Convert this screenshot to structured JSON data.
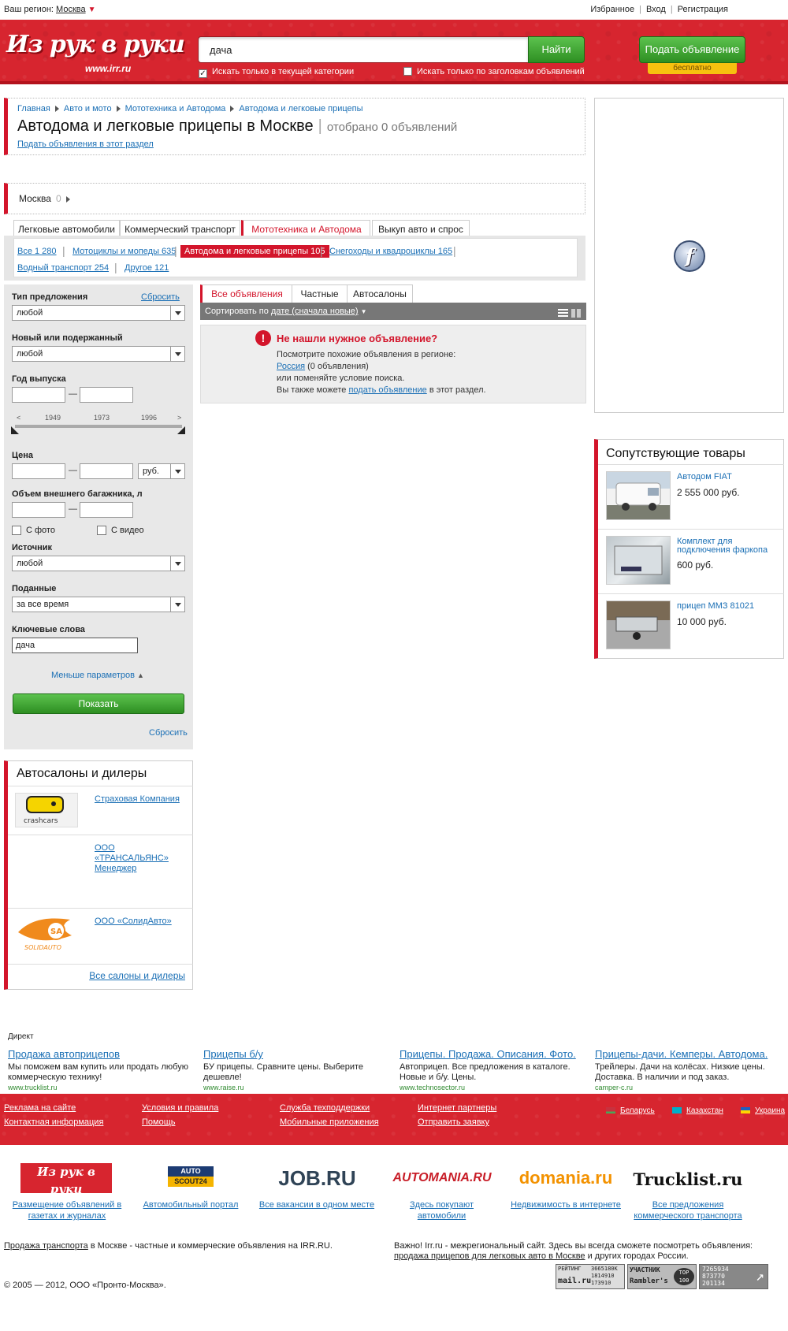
{
  "topbar": {
    "region_label": "Ваш регион:",
    "region_value": "Москва",
    "favorites": "Избранное",
    "login": "Вход",
    "register": "Регистрация"
  },
  "header": {
    "logo": "Из рук в руки",
    "logo_url": "www.irr.ru",
    "search_value": "дача",
    "find_button": "Найти",
    "chk_current_category": "Искать только в текущей категории",
    "chk_titles_only": "Искать только по заголовкам объявлений",
    "post_button": "Подать объявление",
    "post_free": "бесплатно"
  },
  "breadcrumb": [
    "Главная",
    "Авто и мото",
    "Мототехника и Автодома",
    "Автодома и легковые прицепы"
  ],
  "page": {
    "title": "Автодома и легковые прицепы в Москве",
    "count_text": "отобрано 0 объявлений",
    "post_link": "Подать объявления в этот раздел"
  },
  "city": {
    "name": "Москва",
    "count": "0"
  },
  "tabs": [
    "Легковые автомобили",
    "Коммерческий транспорт",
    "Мототехника и Автодома",
    "Выкуп авто и спрос"
  ],
  "subcats": [
    "Все 1 280",
    "Мотоциклы и мопеды 635",
    "Автодома и легковые прицепы 105",
    "Снегоходы и квадроциклы 165",
    "Водный транспорт 254",
    "Другое 121"
  ],
  "filter": {
    "offer_type_label": "Тип предложения",
    "reset_top": "Сбросить",
    "offer_type_value": "любой",
    "new_used_label": "Новый или подержанный",
    "new_used_value": "любой",
    "year_label": "Год выпуска",
    "slider_ticks": [
      "<",
      "1949",
      "1973",
      "1996",
      ">"
    ],
    "price_label": "Цена",
    "currency": "руб.",
    "trunk_label": "Объем внешнего багажника, л",
    "with_photo": "С фото",
    "with_video": "С видео",
    "source_label": "Источник",
    "source_value": "любой",
    "submitted_label": "Поданные",
    "submitted_value": "за все время",
    "keywords_label": "Ключевые слова",
    "keywords_value": "дача",
    "fewer_params": "Меньше параметров",
    "show_button": "Показать",
    "reset_bottom": "Сбросить"
  },
  "results": {
    "tabs": [
      "Все объявления",
      "Частные",
      "Автосалоны"
    ],
    "sort_prefix": "Сортировать по",
    "sort_value": "дате (сначала новые)",
    "notfound_title": "Не нашли нужное объявление?",
    "notfound_line1": "Посмотрите похожие объявления в регионе:",
    "notfound_region": "Россия",
    "notfound_region_count": "(0 объявления)",
    "notfound_line3": "или поменяйте условие поиска.",
    "notfound_line4_pre": "Вы также можете",
    "notfound_line4_link": "подать объявление",
    "notfound_line4_post": "в этот раздел."
  },
  "related": {
    "title": "Сопутствующие товары",
    "items": [
      {
        "title": "Автодом FIAT",
        "price": "2 555 000 руб."
      },
      {
        "title": "Комплект для подключения фаркопа",
        "price": "600 руб."
      },
      {
        "title": "прицеп ММЗ 81021",
        "price": "10 000 руб."
      }
    ]
  },
  "dealers": {
    "title": "Автосалоны и дилеры",
    "items": [
      "Страховая Компания",
      "ООО «ТРАНСАЛЬЯНС» Менеджер",
      "ООО «СолидАвто»"
    ],
    "logo_texts": [
      "crashcars",
      "SOLIDAUTO"
    ],
    "all_link": "Все салоны и дилеры"
  },
  "direct": {
    "label": "Директ",
    "ads": [
      {
        "title": "Продажа автоприцепов",
        "desc": "Мы поможем вам купить или продать любую коммерческую технику!",
        "url": "www.trucklist.ru"
      },
      {
        "title": "Прицепы б/у",
        "desc": "БУ прицепы. Сравните цены. Выберите дешевле!",
        "url": "www.raise.ru"
      },
      {
        "title": "Прицепы. Продажа. Описания. Фото.",
        "desc": "Автоприцеп. Все предложения в каталоге. Новые и б/у. Цены.",
        "url": "www.technosector.ru"
      },
      {
        "title": "Прицепы-дачи. Кемперы. Автодома.",
        "desc": "Трейлеры. Дачи на колёсах. Низкие цены. Доставка. В наличии и под заказ.",
        "url": "camper-c.ru"
      }
    ]
  },
  "footer": {
    "links_col1": [
      "Реклама на сайте",
      "Контактная информация"
    ],
    "links_col2": [
      "Условия и правила",
      "Помощь"
    ],
    "links_col3": [
      "Служба техподдержки",
      "Мобильные приложения"
    ],
    "links_col4": [
      "Интернет партнеры",
      "Отправить заявку"
    ],
    "countries": [
      "Беларусь",
      "Казахстан",
      "Украина"
    ]
  },
  "partners": [
    {
      "logo": "Из рук в руки",
      "logo_sub": "ИНТЕРНЕТ - ОФИС",
      "caption": "Размещение объявлений в газетах и журналах"
    },
    {
      "logo": "AUTO",
      "logo_sub": "SCOUT24",
      "caption": "Автомобильный портал"
    },
    {
      "logo": "JOB.RU",
      "caption": "Все вакансии в одном месте"
    },
    {
      "logo": "AUTOMANIA.RU",
      "caption": "Здесь покупают автомобили"
    },
    {
      "logo": "domania.ru",
      "caption": "Недвижимость в интернете"
    },
    {
      "logo": "Trucklist.ru",
      "caption": "Все предложения коммерческого транспорта"
    }
  ],
  "bottom": {
    "left_link": "Продажа транспорта",
    "left_rest": "в Москве - частные и коммерческие объявления на IRR.RU.",
    "right_pre": "Важно! Irr.ru - межрегиональный сайт. Здесь вы всегда сможете посмотреть объявления:",
    "right_link": "продажа прицепов для легковых авто в Москве",
    "right_post": "и других городах России.",
    "copyright": "© 2005 — 2012, ООО «Пронто-Москва».",
    "counters": [
      {
        "label": "РЕЙТИНГ",
        "brand": "mail.ru",
        "values": [
          "3665180K",
          "1814910",
          "173910"
        ]
      },
      {
        "label": "УЧАСТНИК",
        "brand": "Rambler's",
        "badge": "TOP 100"
      },
      {
        "values": [
          "7265934",
          "873770",
          "201134"
        ]
      }
    ]
  },
  "colors": {
    "brand_red": "#d7252f",
    "green": "#3aa22d",
    "link": "#1a6fb5",
    "yellow": "#f7c10f"
  }
}
